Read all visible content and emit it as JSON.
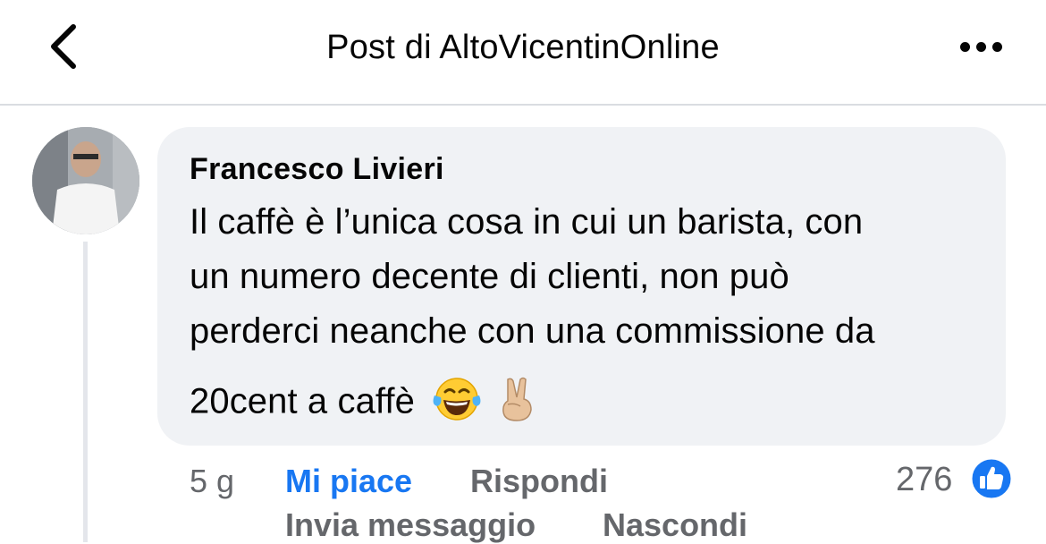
{
  "header": {
    "title": "Post di AltoVicentinOnline",
    "back_icon": "chevron-left-icon",
    "more_icon": "more-horizontal-icon"
  },
  "comment": {
    "author": "Francesco Livieri",
    "lines": [
      "Il caffè è l’unica cosa in cui un barista, con",
      "un numero decente di clienti, non può",
      "perderci neanche con una commissione da",
      "20cent a caffè"
    ],
    "emojis": [
      "😂",
      "✌🏼"
    ],
    "time": "5 g",
    "actions": {
      "like": "Mi piace",
      "reply": "Rispondi",
      "message": "Invia messaggio",
      "hide": "Nascondi"
    },
    "reaction_count": "276",
    "reaction_icon": "like-thumb-icon"
  },
  "colors": {
    "accent": "#1877f2",
    "bubble": "#f0f2f5",
    "secondary_text": "#65676b"
  }
}
